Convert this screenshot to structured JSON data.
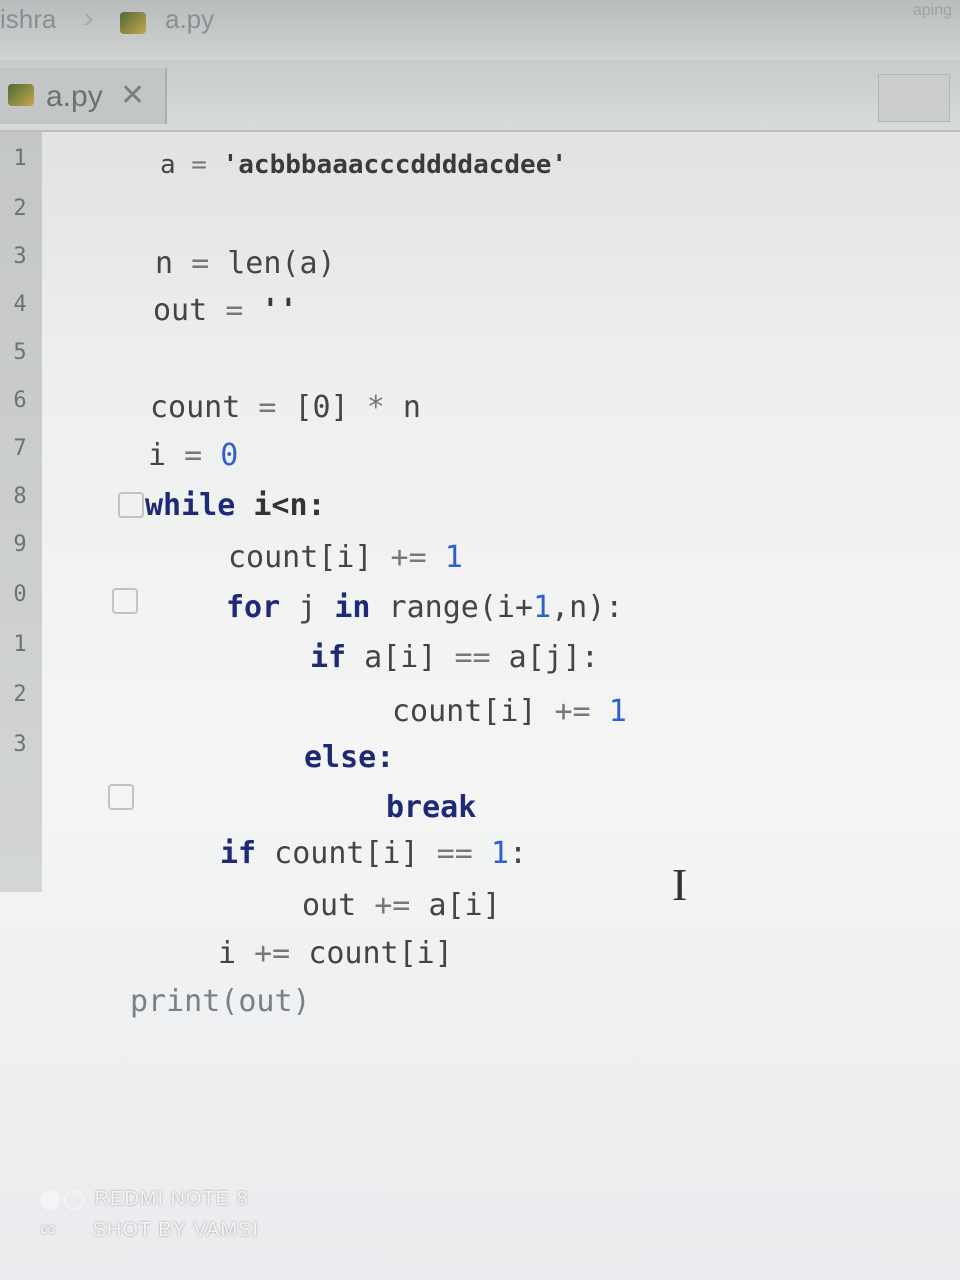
{
  "breadcrumb": {
    "project": "ishra",
    "file": "a.py"
  },
  "top_right": "aping",
  "tab": {
    "label": "a.py",
    "close": "✕"
  },
  "gutter": {
    "lines": [
      "1",
      "2",
      "3",
      "4",
      "5",
      "6",
      "7",
      "8",
      "9",
      "0",
      "1",
      "2",
      "3"
    ]
  },
  "code": {
    "l1": {
      "var": "a",
      "op": " = ",
      "str": "'acbbbaaacccddddacdee'"
    },
    "l2": {
      "var": "n",
      "op": " = ",
      "fn": "len(a)"
    },
    "l3": {
      "var": "out",
      "op": " = ",
      "str": "''"
    },
    "l4": {
      "var": "count",
      "op": " = ",
      "rest": "[0]",
      "op2": " * ",
      "var2": "n"
    },
    "l5": {
      "var": "i",
      "op": " = ",
      "num": "0"
    },
    "l6": {
      "kw": "while",
      "rest": " i<n:"
    },
    "l7": {
      "var": "count[i]",
      "op": " += ",
      "num": "1"
    },
    "l8": {
      "kw": "for",
      "v1": " j ",
      "kw2": "in",
      "rest": " range(i+",
      "num": "1",
      "rest2": ",n):"
    },
    "l9": {
      "kw": "if",
      "rest": " a[i] ",
      "op": "==",
      "rest2": " a[j]:"
    },
    "l10": {
      "var": "count[i]",
      "op": " += ",
      "num": "1"
    },
    "l11": {
      "kw": "else:"
    },
    "l12": {
      "kw": "break"
    },
    "l13": {
      "kw": "if",
      "rest": " count[i] ",
      "op": "==",
      "num": " 1",
      "rest2": ":"
    },
    "l14": {
      "var": "out",
      "op": " += ",
      "rest": "a[i]"
    },
    "l15": {
      "var": "i",
      "op": " += ",
      "rest": "count[i]"
    },
    "l16": {
      "var": "print(out)"
    }
  },
  "watermark": {
    "line1": "REDMI NOTE 8",
    "line2": "SHOT BY VAMSI"
  },
  "colors": {
    "keyword": "#1e2a78",
    "number": "#2e5fd0",
    "text": "#444444"
  }
}
